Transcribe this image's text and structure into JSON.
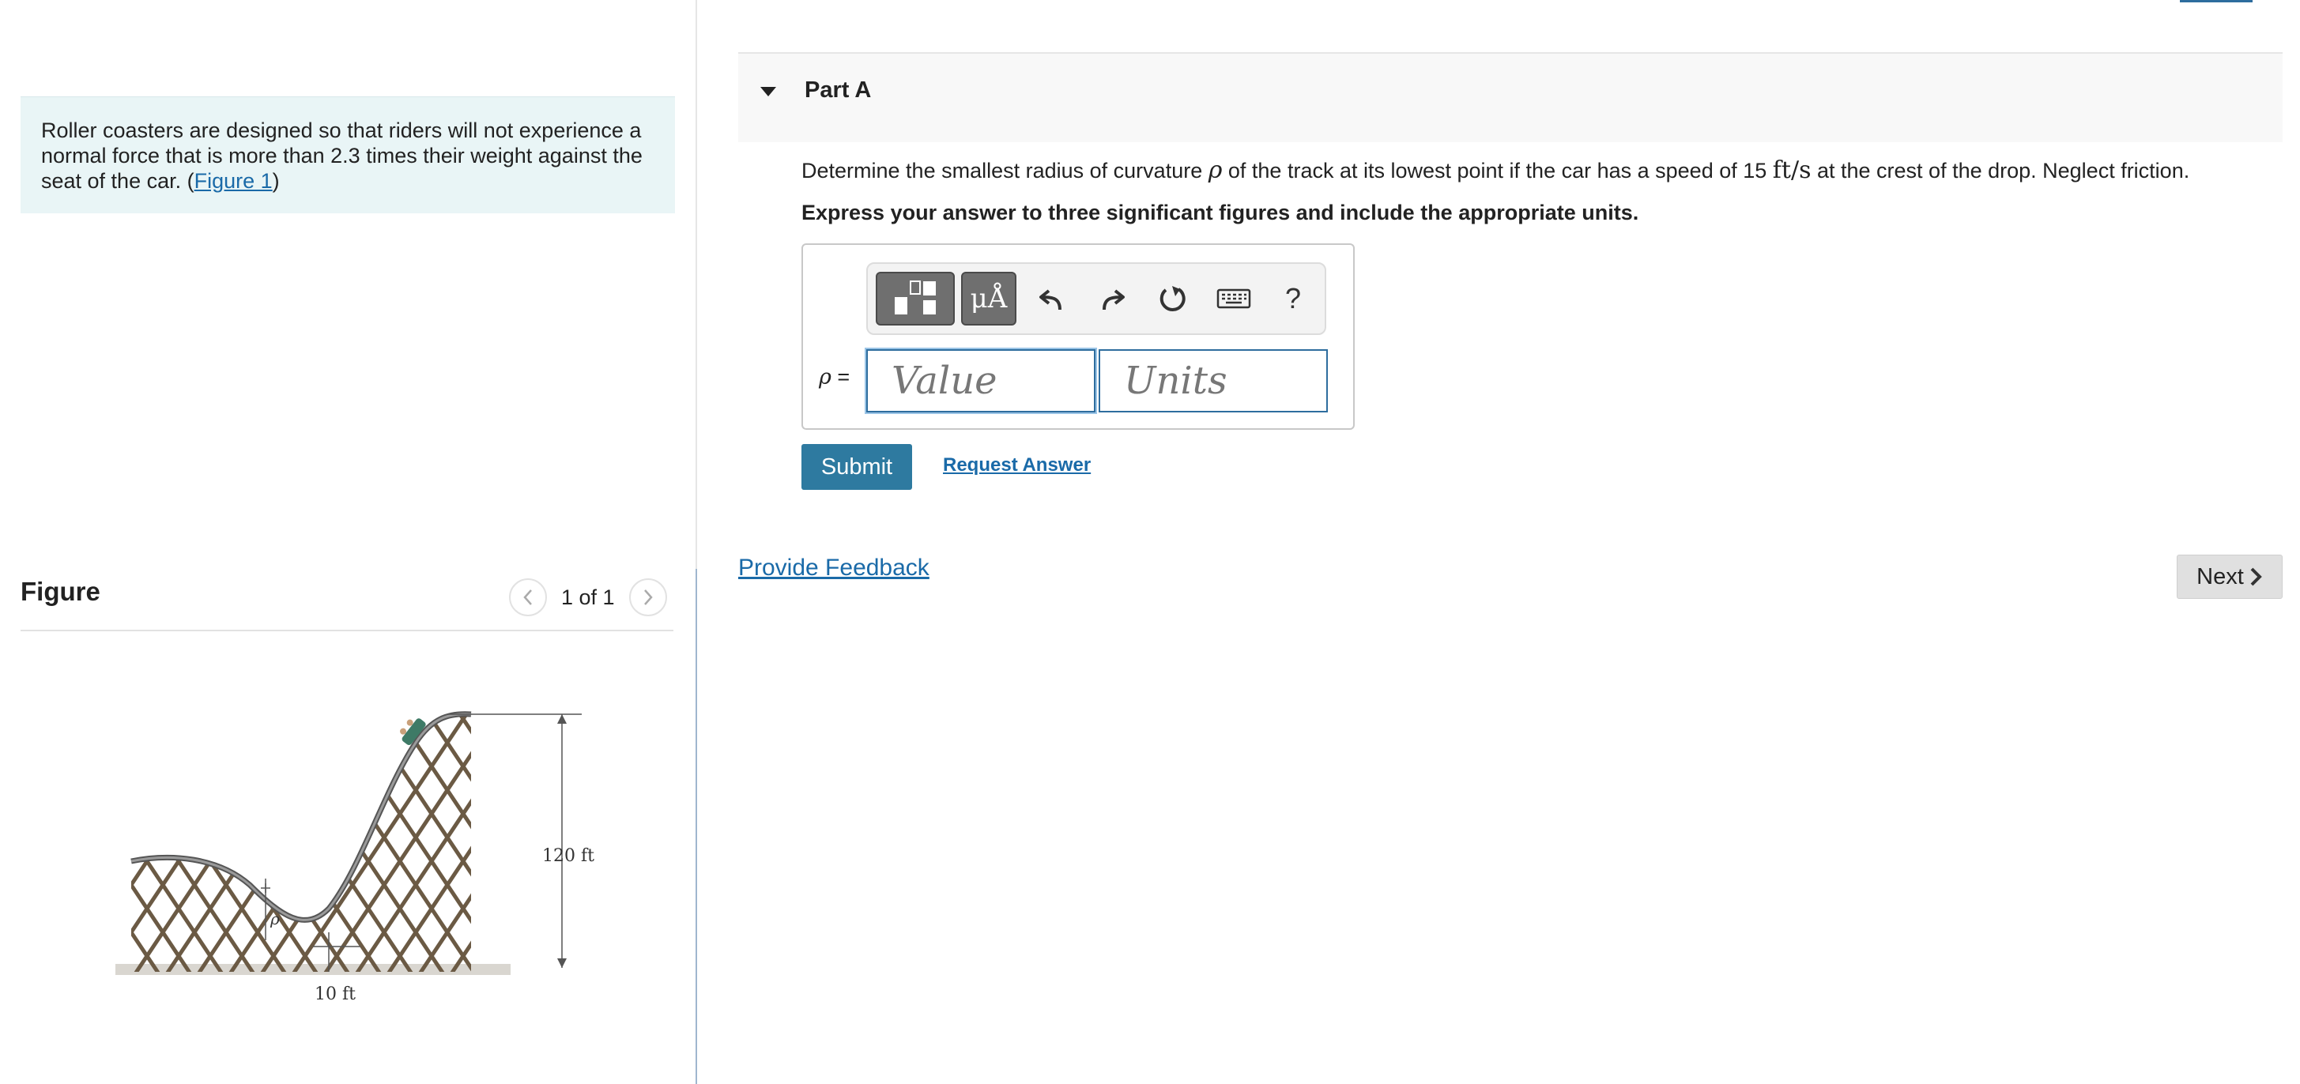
{
  "intro": {
    "text_before": "Roller coasters are designed so that riders will not experience a normal force that is more than 2.3 times their weight against the seat of the car. (",
    "figure_link": "Figure 1",
    "text_after": ")"
  },
  "figure": {
    "title": "Figure",
    "page_count": "1 of 1",
    "labels": {
      "height": "120 ft",
      "base": "10 ft",
      "radius_symbol": "ρ"
    }
  },
  "part": {
    "title": "Part A",
    "question_before": "Determine the smallest radius of curvature",
    "symbol": "ρ",
    "question_middle": "of the track at its lowest point if the car has a speed of 15",
    "unit": "ft/s",
    "question_after": "at the crest of the drop. Neglect friction.",
    "instruction": "Express your answer to three significant figures and include the appropriate units."
  },
  "answer": {
    "variable": "ρ",
    "equals": "=",
    "value_placeholder": "Value",
    "units_placeholder": "Units",
    "toolbar": {
      "units_label": "μÅ",
      "help_label": "?"
    }
  },
  "actions": {
    "submit_label": "Submit",
    "request_answer_label": "Request Answer",
    "feedback_label": "Provide Feedback",
    "next_label": "Next"
  }
}
